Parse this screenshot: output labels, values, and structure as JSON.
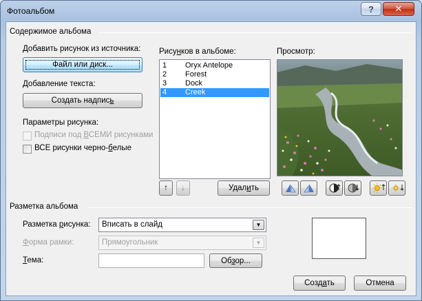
{
  "window": {
    "title": "Фотоальбом",
    "help_glyph": "?",
    "close_glyph": "✕"
  },
  "album_content": {
    "group_title": "Содержимое альбома",
    "add_picture_label": "Добавить рисунок из источника:",
    "file_disk_button": {
      "pre": "Файл или ",
      "accel": "д",
      "post": "иск..."
    },
    "add_text_label": "Добавление текста:",
    "create_caption_button": {
      "pre": "Создать надпис",
      "accel": "ь",
      "post": ""
    },
    "picture_options_label": "Параметры рисунка:",
    "captions_all_checkbox": {
      "pre": "Подписи под ",
      "accel": "В",
      "post": "СЕМИ рисунками",
      "checked": false,
      "enabled": false
    },
    "all_bw_checkbox": {
      "pre": "ВСЕ рисунки черно-",
      "accel": "б",
      "post": "елые",
      "checked": false,
      "enabled": true
    }
  },
  "pictures": {
    "label": {
      "pre": "Рису",
      "accel": "н",
      "post": "ков в альбоме:"
    },
    "items": [
      {
        "num": "1",
        "name": "Oryx Antelope",
        "selected": false
      },
      {
        "num": "2",
        "name": "Forest",
        "selected": false
      },
      {
        "num": "3",
        "name": "Dock",
        "selected": false
      },
      {
        "num": "4",
        "name": "Creek",
        "selected": true
      }
    ],
    "move_up_glyph": "↑",
    "move_down_glyph": "↓",
    "delete_button": {
      "pre": "Удал",
      "accel": "и",
      "post": "ть"
    }
  },
  "preview": {
    "label": "Просмотр:",
    "image": "creek-landscape-photo"
  },
  "album_layout": {
    "group_title": "Разметка альбома",
    "picture_layout_label": {
      "pre": "Разметка ",
      "accel": "р",
      "post": "исунка:"
    },
    "picture_layout_value": "Вписать в слайд",
    "frame_shape_label": {
      "pre": "",
      "accel": "Ф",
      "post": "орма рамки:"
    },
    "frame_shape_value": "Прямоугольник",
    "theme_label": {
      "pre": "",
      "accel": "Т",
      "post": "ема:"
    },
    "theme_value": "",
    "browse_button": {
      "pre": "Об",
      "accel": "з",
      "post": "ор..."
    }
  },
  "footer": {
    "create_button": {
      "pre": "Созд",
      "accel": "а",
      "post": "ть"
    },
    "cancel_button": "Отмена"
  },
  "colors": {
    "selection": "#3399ff",
    "window_frame": "#b8cce4",
    "close_button": "#c83f24"
  }
}
